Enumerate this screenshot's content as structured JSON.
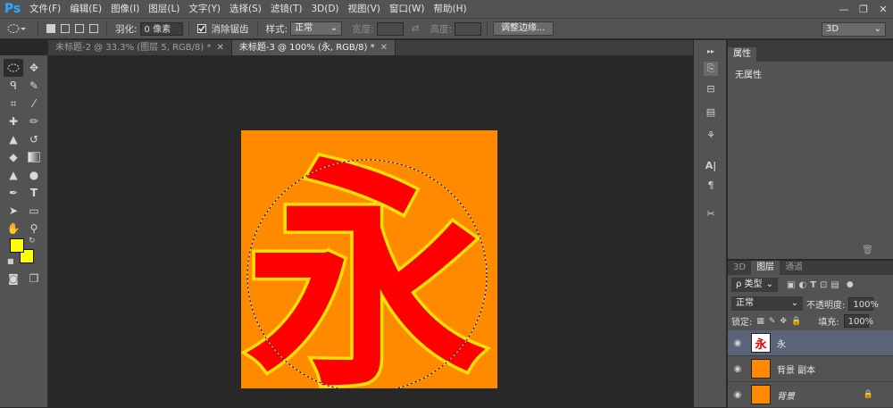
{
  "app": {
    "logo": "Ps"
  },
  "menu": [
    "文件(F)",
    "编辑(E)",
    "图像(I)",
    "图层(L)",
    "文字(Y)",
    "选择(S)",
    "滤镜(T)",
    "3D(D)",
    "视图(V)",
    "窗口(W)",
    "帮助(H)"
  ],
  "window_controls": {
    "minimize": "—",
    "restore": "❐",
    "close": "✕"
  },
  "options": {
    "feather_label": "羽化:",
    "feather_value": "0 像素",
    "antialias_label": "消除锯齿",
    "style_label": "样式:",
    "style_value": "正常",
    "width_label": "宽度:",
    "height_label": "高度:",
    "refine_button": "调整边缘...",
    "workspace_value": "3D"
  },
  "tabs": [
    {
      "label": "未标题-2 @ 33.3% (图层 5, RGB/8) *",
      "active": false
    },
    {
      "label": "未标题-3 @ 100% (永, RGB/8) *",
      "active": true
    }
  ],
  "canvas": {
    "glyph": "永"
  },
  "properties_panel": {
    "tab_label": "属性",
    "content": "无属性"
  },
  "layers_panel": {
    "tabs": [
      "3D",
      "图层",
      "通道"
    ],
    "filter_label": "ρ 类型",
    "blend_mode": "正常",
    "opacity_label": "不透明度:",
    "opacity_value": "100%",
    "lock_label": "锁定:",
    "fill_label": "填充:",
    "fill_value": "100%",
    "layers": [
      {
        "name": "永",
        "thumb": "永",
        "selected": true,
        "locked": false
      },
      {
        "name": "背景 副本",
        "thumb": "",
        "selected": false,
        "locked": false
      },
      {
        "name": "背景",
        "thumb": "",
        "selected": false,
        "locked": true
      }
    ]
  },
  "colors": {
    "accent": "#31a8ff",
    "canvas_bg": "#ff8a00",
    "glyph_fill": "#ff0000",
    "glyph_stroke": "#ffe000",
    "foreground": "#ffff00",
    "background": "#ffff00",
    "selected_layer": "#5a6478"
  }
}
